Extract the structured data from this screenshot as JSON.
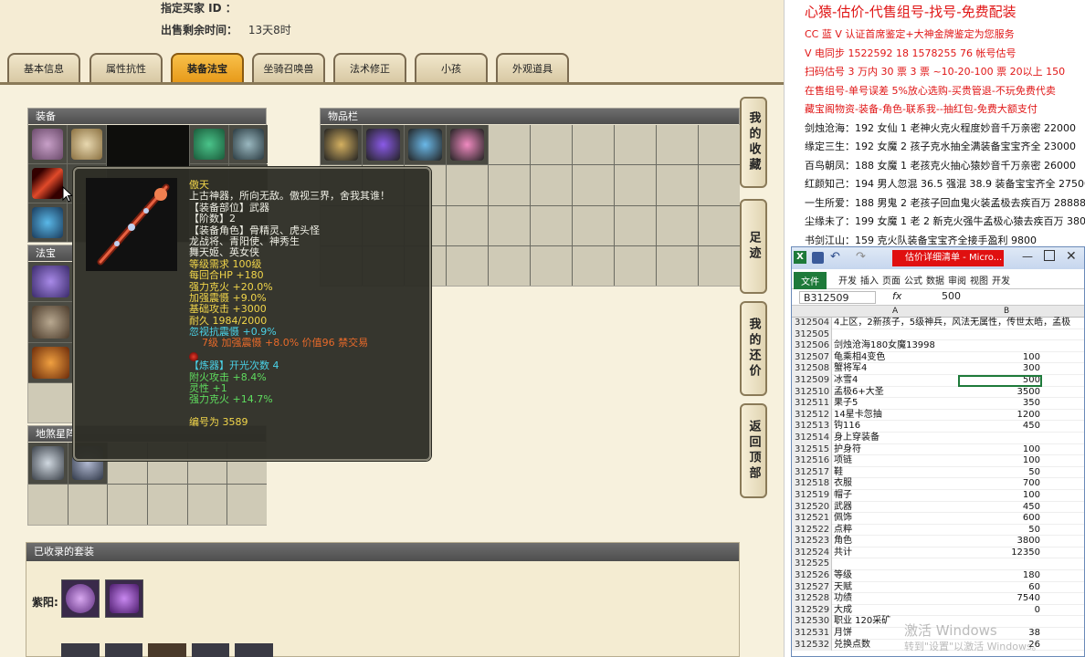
{
  "header": {
    "seller_label": "指定买家 ID ：",
    "time_label": "出售剩余时间：",
    "time_value": "13天8时"
  },
  "tabs": [
    {
      "label": "基本信息",
      "active": false
    },
    {
      "label": "属性抗性",
      "active": false
    },
    {
      "label": "装备法宝",
      "active": true
    },
    {
      "label": "坐骑召唤兽",
      "active": false
    },
    {
      "label": "法术修正",
      "active": false
    },
    {
      "label": "小孩",
      "active": false
    },
    {
      "label": "外观道具",
      "active": false
    }
  ],
  "panels": {
    "equipment": "装备",
    "inventory": "物品栏",
    "fabao": "法宝",
    "dishax": "地煞星阵",
    "set": "已收录的套装",
    "set_label": "紫阳:"
  },
  "side_buttons": [
    "我的收藏",
    "足迹",
    "我的还价",
    "返回顶部"
  ],
  "tooltip": {
    "name": "傲天",
    "lines": [
      {
        "text": "上古神器，所向无敌。傲视三界，舍我其谁！",
        "color": "w"
      },
      {
        "text": "【装备部位】武器",
        "color": "w"
      },
      {
        "text": "【阶数】2",
        "color": "w"
      },
      {
        "text": "【装备角色】骨精灵、虎头怪",
        "color": "w"
      },
      {
        "text": "龙战将、青阳使、神秀生",
        "color": "w"
      },
      {
        "text": "舞天姬、英女侠",
        "color": "w"
      },
      {
        "text": "等级需求 100级",
        "color": "y"
      },
      {
        "text": "每回合HP +180",
        "color": "y"
      },
      {
        "text": "强力克火 +20.0%",
        "color": "y"
      },
      {
        "text": "加强震慑 +9.0%",
        "color": "y"
      },
      {
        "text": "基础攻击 +3000",
        "color": "y"
      },
      {
        "text": "耐久 1984/2000",
        "color": "y"
      },
      {
        "text": "忽视抗震慑 +0.9%",
        "color": "c"
      },
      {
        "text": "7级 加强震慑 +8.0% 价值96 禁交易",
        "color": "o"
      },
      {
        "text": "",
        "color": "w"
      },
      {
        "text": "【炼器】开光次数 4",
        "color": "c"
      },
      {
        "text": "附火攻击 +8.4%",
        "color": "g"
      },
      {
        "text": "灵性 +1",
        "color": "g"
      },
      {
        "text": "强力克火 +14.7%",
        "color": "g"
      },
      {
        "text": "",
        "color": "w"
      },
      {
        "text": "编号为 3589",
        "color": "y"
      }
    ]
  },
  "ads": [
    {
      "text": "心猿-估价-代售组号-找号-免费配装",
      "color": "red",
      "big": true
    },
    {
      "text": "CC 蓝 V 认证首席鉴定+大神金牌鉴定为您服务",
      "color": "red"
    },
    {
      "text": "V 电同步 1522592 18 1578255 76 帐号估号",
      "color": "red"
    },
    {
      "text": "扫码估号 3 万内 30 票 3 票 ~10-20-100 票 20以上 150",
      "color": "red"
    },
    {
      "text": "在售组号-单号误差 5%放心选购-买贵管退-不玩免费代卖",
      "color": "red"
    },
    {
      "text": "藏宝阁物资-装备-角色-联系我--抽红包-免费大额支付",
      "color": "red"
    },
    {
      "text": "剑烛沧海：192 女仙 1 老神火克火程度妙音千万亲密 22000",
      "color": "blk"
    },
    {
      "text": "缘定三生：192 女魔 2 孩子克水抽全满装备宝宝齐全 23000",
      "color": "blk"
    },
    {
      "text": "百鸟朝凤：188 女魔 1 老孩克火抽心猿妙音千万亲密 26000",
      "color": "blk"
    },
    {
      "text": "红颜知己：194 男人忽混 36.5 强混 38.9 装备宝宝齐全 27500",
      "color": "blk"
    },
    {
      "text": "一生所爱：188 男鬼 2 老孩子回血鬼火装孟极去疾百万 28888",
      "color": "blk"
    },
    {
      "text": "尘缘未了：199 女魔 1 老 2 新克火强牛孟极心猿去疾百万 380",
      "color": "blk"
    },
    {
      "text": "书剑江山：159 克火队装备宝宝齐全接手盈利 9800",
      "color": "blk"
    }
  ],
  "excel": {
    "title": "估价详细清单 - Micro...",
    "ribbon_tabs": [
      "文件",
      "开发",
      "插入",
      "页面",
      "公式",
      "数据",
      "审阅",
      "视图",
      "开发"
    ],
    "cell_ref": "B312509",
    "fx": "fx",
    "formula": "500",
    "col_a": "A",
    "col_b": "B",
    "rows": [
      {
        "n": "312504",
        "a": "4上区，2新孩子，5级神兵，风法无属性，传世太皓，孟极",
        "b": ""
      },
      {
        "n": "312505",
        "a": "",
        "b": ""
      },
      {
        "n": "312506",
        "a": "剑烛沧海180女魔13998",
        "b": ""
      },
      {
        "n": "312507",
        "a": "龟乘相4变色",
        "b": "100"
      },
      {
        "n": "312508",
        "a": "蟹将军4",
        "b": "300"
      },
      {
        "n": "312509",
        "a": "冰雪4",
        "b": "500"
      },
      {
        "n": "312510",
        "a": "孟极6+大圣",
        "b": "3500"
      },
      {
        "n": "312511",
        "a": "果子5",
        "b": "350"
      },
      {
        "n": "312512",
        "a": "14星卡忽抽",
        "b": "1200"
      },
      {
        "n": "312513",
        "a": "钩116",
        "b": "450"
      },
      {
        "n": "312514",
        "a": "身上穿装备",
        "b": ""
      },
      {
        "n": "312515",
        "a": "护身符",
        "b": "100"
      },
      {
        "n": "312516",
        "a": "项链",
        "b": "100"
      },
      {
        "n": "312517",
        "a": "鞋",
        "b": "50"
      },
      {
        "n": "312518",
        "a": "衣服",
        "b": "700"
      },
      {
        "n": "312519",
        "a": "帽子",
        "b": "100"
      },
      {
        "n": "312520",
        "a": "武器",
        "b": "450"
      },
      {
        "n": "312521",
        "a": "佩饰",
        "b": "600"
      },
      {
        "n": "312522",
        "a": "点粹",
        "b": "50"
      },
      {
        "n": "312523",
        "a": "角色",
        "b": "3800"
      },
      {
        "n": "312524",
        "a": "共计",
        "b": "12350"
      },
      {
        "n": "312525",
        "a": "",
        "b": ""
      },
      {
        "n": "312526",
        "a": "等级",
        "b": "180"
      },
      {
        "n": "312527",
        "a": "天赋",
        "b": "60"
      },
      {
        "n": "312528",
        "a": "功绩",
        "b": "7540"
      },
      {
        "n": "312529",
        "a": "大成",
        "b": "0"
      },
      {
        "n": "312530",
        "a": "职业        120采矿",
        "b": ""
      },
      {
        "n": "312531",
        "a": "月饼",
        "b": "38"
      },
      {
        "n": "312532",
        "a": "兑换点数",
        "b": "26"
      }
    ]
  },
  "watermark": {
    "line1": "激活 Windows",
    "line2": "转到\"设置\"以激活 Windows。"
  }
}
